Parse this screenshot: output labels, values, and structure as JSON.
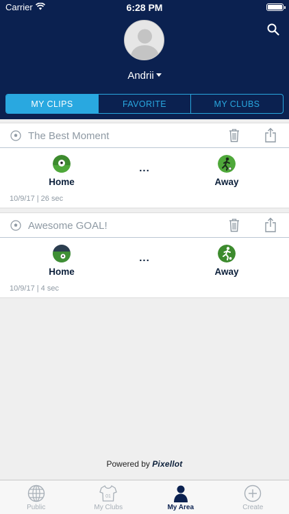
{
  "status_bar": {
    "carrier": "Carrier",
    "time": "6:28 PM"
  },
  "header": {
    "user_name": "Andrii",
    "search_icon": "search-icon",
    "avatar_icon": "person-silhouette-icon"
  },
  "tabs": [
    {
      "label": "MY CLIPS",
      "active": true
    },
    {
      "label": "FAVORITE",
      "active": false
    },
    {
      "label": "MY CLUBS",
      "active": false
    }
  ],
  "clips": [
    {
      "title": "The Best Moment",
      "home": "Home",
      "away": "Away",
      "separator": "...",
      "meta": "10/9/17 | 26 sec"
    },
    {
      "title": "Awesome GOAL!",
      "home": "Home",
      "away": "Away",
      "separator": "...",
      "meta": "10/9/17 | 4 sec"
    }
  ],
  "footer": {
    "powered_by": "Powered by",
    "brand": "Pixellot"
  },
  "tabbar": [
    {
      "label": "Public",
      "icon": "globe-icon",
      "active": false
    },
    {
      "label": "My Clubs",
      "icon": "jersey-icon",
      "active": false
    },
    {
      "label": "My Area",
      "icon": "person-icon",
      "active": true
    },
    {
      "label": "Create",
      "icon": "plus-circle-icon",
      "active": false
    }
  ],
  "colors": {
    "header_bg": "#0b2150",
    "accent": "#29a8e0",
    "team_logo_green": "#3d8b2e"
  }
}
